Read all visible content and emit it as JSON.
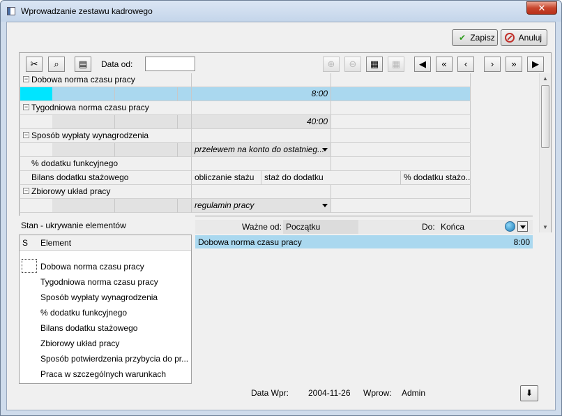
{
  "window": {
    "title": "Wprowadzanie zestawu kadrowego",
    "close_glyph": "✕"
  },
  "actions": {
    "save_label": "Zapisz",
    "cancel_label": "Anuluj"
  },
  "toolbar": {
    "data_od_label": "Data od:",
    "data_od_value": "",
    "nav": [
      "◀",
      "«",
      "‹",
      "›",
      "»",
      "▶"
    ]
  },
  "grid": {
    "rows": [
      {
        "label": "Dobowa norma czasu pracy",
        "type": "group"
      },
      {
        "value": "8:00",
        "type": "value-selected"
      },
      {
        "label": "Tygodniowa norma czasu pracy",
        "type": "group"
      },
      {
        "value": "40:00",
        "type": "value"
      },
      {
        "label": "Sposób wypłaty wynagrodzenia",
        "type": "group"
      },
      {
        "value": "przelewem na konto do ostatnieg...",
        "type": "dropdown"
      },
      {
        "label": "% dodatku funkcyjnego",
        "type": "plain"
      },
      {
        "label": "Bilans dodatku stażowego",
        "type": "plain",
        "cols": [
          "obliczanie stażu",
          "staż do dodatku",
          "% dodatku stażo..."
        ]
      },
      {
        "label": "Zbiorowy układ pracy",
        "type": "group"
      },
      {
        "value": "regulamin pracy",
        "type": "dropdown"
      }
    ]
  },
  "left_panel": {
    "title": "Stan - ukrywanie elementów",
    "col_s": "S",
    "col_element": "Element",
    "items": [
      "Dobowa norma czasu pracy",
      "Tygodniowa norma czasu pracy",
      "Sposób wypłaty wynagrodzenia",
      "% dodatku funkcyjnego",
      "Bilans dodatku stażowego",
      "Zbiorowy układ pracy",
      "Sposób potwierdzenia przybycia do pr...",
      "Praca w szczególnych warunkach"
    ]
  },
  "right_panel": {
    "valid_from_label": "Ważne od:",
    "valid_from_value": "Początku",
    "to_label": "Do:",
    "to_value": "Końca",
    "row_name": "Dobowa norma czasu pracy",
    "row_value": "8:00"
  },
  "footer": {
    "data_wpr_label": "Data Wpr:",
    "data_wpr_value": "2004-11-26",
    "wprow_label": "Wprow:",
    "wprow_value": "Admin"
  }
}
